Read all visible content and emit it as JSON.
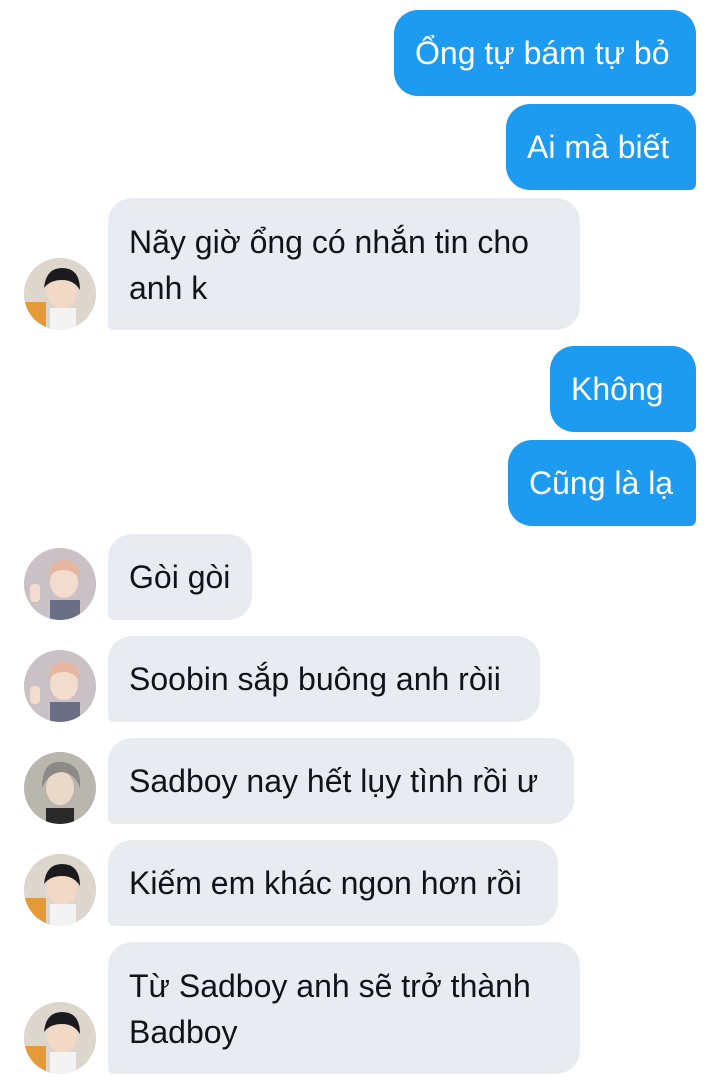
{
  "messages": [
    {
      "side": "out",
      "text": "Ổng tự bám tự bỏ"
    },
    {
      "side": "out",
      "text": "Ai mà biết"
    },
    {
      "side": "in",
      "avatar": "profile-photo-dark-hair-icon",
      "text": "Nãy giờ ổng có nhắn tin cho anh k"
    },
    {
      "side": "out",
      "text": "Không"
    },
    {
      "side": "out",
      "text": "Cũng là lạ"
    },
    {
      "side": "in",
      "avatar": "profile-photo-pink-hair-icon",
      "text": "Gòi gòi"
    },
    {
      "side": "in",
      "avatar": "profile-photo-pink-hair-icon",
      "text": "Soobin sắp buông anh ròii"
    },
    {
      "side": "in",
      "avatar": "profile-photo-grey-hair-icon",
      "text": "Sadboy nay hết lụy tình rồi ư"
    },
    {
      "side": "in",
      "avatar": "profile-photo-dark-hair-icon",
      "text": "Kiếm em khác ngon hơn rồi"
    },
    {
      "side": "in",
      "avatar": "profile-photo-dark-hair-icon",
      "text": "Từ Sadboy anh sẽ trở thành Badboy"
    }
  ],
  "colors": {
    "outgoing_bubble": "#1d9bf0",
    "incoming_bubble": "#e8ecf0",
    "incoming_text": "#0f1419",
    "outgoing_text": "#ffffff"
  }
}
